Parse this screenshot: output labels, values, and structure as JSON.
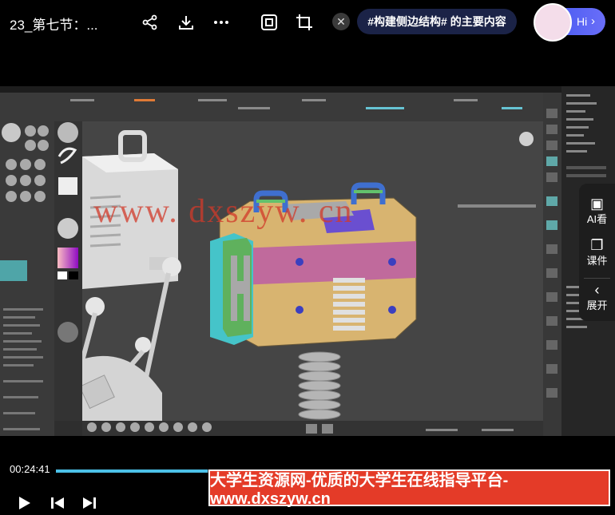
{
  "header": {
    "title": "23_第七节：...",
    "topic_tag": "#构建侧边结构# 的主要内容",
    "assistant_label": "Hi",
    "icons": [
      "share-icon",
      "download-icon",
      "more-icon",
      "screen-capture-icon",
      "crop-icon",
      "close-icon"
    ]
  },
  "watermark": "www. dxszyw. cn",
  "side_panel": {
    "ai_label": "AI看",
    "courseware_label": "课件",
    "expand_label": "展开"
  },
  "player": {
    "current_time": "00:24:41",
    "progress_fraction": 0.276,
    "banner": "大学生资源网-优质的大学生在线指导平台-www.dxszyw.cn"
  },
  "colors": {
    "accent": "#4cc1e8",
    "banner": "#e43b28",
    "tag_bg": "#1b2347"
  }
}
